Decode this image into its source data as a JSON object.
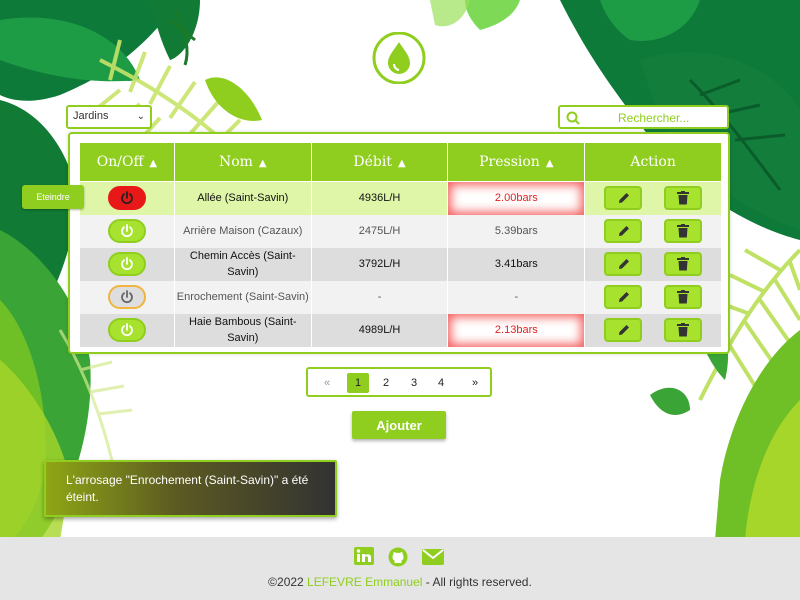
{
  "colors": {
    "accent": "#8fce1e",
    "alert": "#e02020",
    "power_on": "#e81818"
  },
  "filter": {
    "selected": "Jardins"
  },
  "search": {
    "placeholder": "Rechercher..."
  },
  "table": {
    "headers": [
      "On/Off",
      "Nom",
      "Débit",
      "Pression",
      "Action"
    ],
    "rows": [
      {
        "state": "on",
        "nom": "Allée (Saint-Savin)",
        "debit": "4936L/H",
        "pression": "2.00bars",
        "alert": true
      },
      {
        "state": "idle",
        "nom": "Arrière Maison (Cazaux)",
        "debit": "2475L/H",
        "pression": "5.39bars",
        "alert": false
      },
      {
        "state": "idle",
        "nom": "Chemin Accès (Saint-Savin)",
        "debit": "3792L/H",
        "pression": "3.41bars",
        "alert": false
      },
      {
        "state": "off",
        "nom": "Enrochement (Saint-Savin)",
        "debit": "-",
        "pression": "-",
        "alert": false
      },
      {
        "state": "idle",
        "nom": "Haie Bambous (Saint-Savin)",
        "debit": "4989L/H",
        "pression": "2.13bars",
        "alert": true
      }
    ],
    "row_action": "Eteindre"
  },
  "pagination": {
    "prev": "«",
    "pages": [
      "1",
      "2",
      "3",
      "4"
    ],
    "active": "1",
    "next": "»"
  },
  "add_button": "Ajouter",
  "toast": "L'arrosage \"Enrochement (Saint-Savin)\" a été éteint.",
  "footer": {
    "socials": [
      "linkedin-icon",
      "github-icon",
      "email-icon"
    ],
    "copy_prefix": "©2022 ",
    "author": "LEFEVRE Emmanuel",
    "copy_suffix": " - All rights reserved."
  }
}
